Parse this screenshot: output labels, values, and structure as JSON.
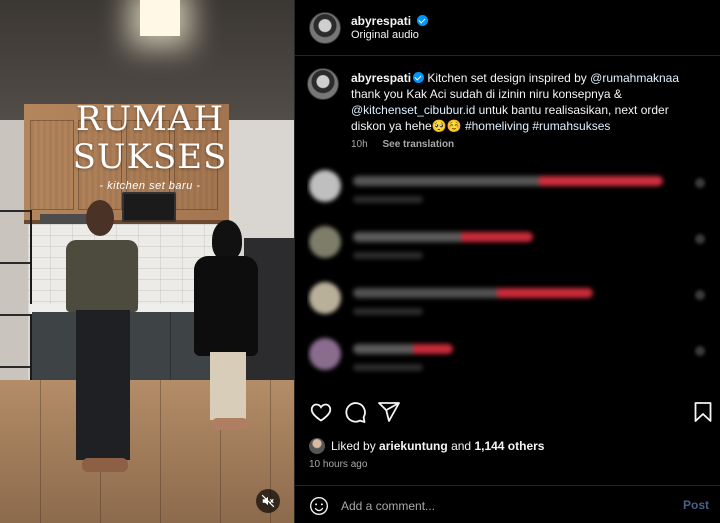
{
  "post": {
    "author": "abyrespati",
    "audio": "Original audio",
    "more": "···"
  },
  "media": {
    "overlay_title": "RUMAH SUKSES",
    "overlay_subtitle": "- kitchen set baru -",
    "mute_icon": "speaker-muted-icon"
  },
  "caption": {
    "author": "abyrespati",
    "text_1": " Kitchen set design inspired by ",
    "mention_1": "@rumahmaknaa",
    "text_2": " thank you Kak Aci sudah di izinin niru konsepnya & ",
    "mention_2": "@kitchenset_cibubur.id",
    "text_3": " untuk bantu realisasikan, next order diskon ya hehe🥺☺️ ",
    "hashtag_1": "#homeliving",
    "hashtag_2": "#rumahsukses",
    "age": "10h",
    "see_translation": "See translation"
  },
  "comments": [
    {
      "avatar_color": "#bfbfbf",
      "line_width": 310,
      "line_color": "#555555",
      "accent": "#d12f3f"
    },
    {
      "avatar_color": "#7d7d6a",
      "line_width": 180,
      "line_color": "#5a5a5a",
      "accent": "#c92a3a"
    },
    {
      "avatar_color": "#b9b09a",
      "line_width": 240,
      "line_color": "#505050",
      "accent": "#c92a3a"
    },
    {
      "avatar_color": "#8a6c8f",
      "line_width": 100,
      "line_color": "#5a5a5a",
      "accent": "#c92a3a"
    }
  ],
  "actions": {
    "like_icon": "heart-icon",
    "comment_icon": "comment-icon",
    "share_icon": "paper-plane-icon",
    "save_icon": "bookmark-icon"
  },
  "likes": {
    "prefix": "Liked by ",
    "user": "ariekuntung",
    "middle": " and ",
    "others": "1,144 others"
  },
  "timestamp": "10 hours ago",
  "add_comment": {
    "placeholder": "Add a comment...",
    "post_label": "Post"
  },
  "colors": {
    "verified": "#0095f6",
    "background": "#000000",
    "post_disabled": "#4a5f8a"
  }
}
